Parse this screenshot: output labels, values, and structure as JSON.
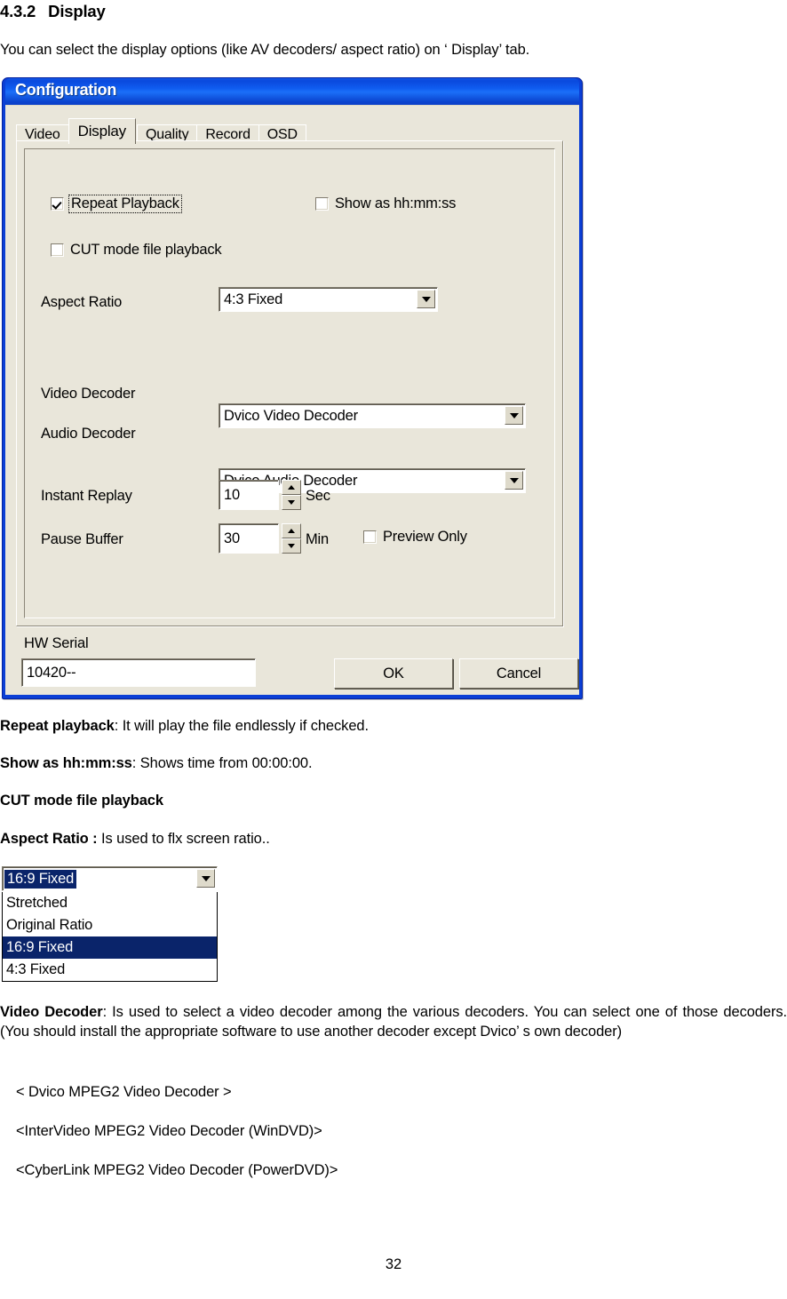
{
  "document": {
    "heading": {
      "number": "4.3.2",
      "title": "Display"
    },
    "intro": "You can select the display options (like AV decoders/ aspect ratio) on ‘ Display’  tab.",
    "notes": [
      {
        "term": "Repeat playback",
        "text": ": It will play the file endlessly if checked."
      },
      {
        "term": "Show as hh:mm:ss",
        "text": ": Shows time from 00:00:00."
      },
      {
        "term": "CUT mode file playback",
        "text": ""
      },
      {
        "term": "Aspect Ratio : ",
        "text": "Is used to flx screen ratio.."
      }
    ],
    "video_decoder_note": {
      "term": "Video Decoder",
      "text": ": Is used to select a video decoder among the various decoders. You can select one of those decoders. (You should install the appropriate software to use another decoder except Dvico’ s own decoder)"
    },
    "decoder_list": [
      "< Dvico MPEG2 Video Decoder >",
      "<InterVideo MPEG2 Video Decoder (WinDVD)>",
      "<CyberLink MPEG2 Video Decoder (PowerDVD)>"
    ],
    "page_number": "32"
  },
  "dialog": {
    "title": "Configuration",
    "tabs": [
      {
        "label": "Video",
        "active": false
      },
      {
        "label": "Display",
        "active": true
      },
      {
        "label": "Quality",
        "active": false
      },
      {
        "label": "Record",
        "active": false
      },
      {
        "label": "OSD",
        "active": false
      }
    ],
    "checkboxes": {
      "repeat_playback": {
        "label": "Repeat Playback",
        "checked": true,
        "focused": true
      },
      "show_as_hhmmss": {
        "label": "Show as hh:mm:ss",
        "checked": false
      },
      "cut_mode_file_playback": {
        "label": "CUT mode file playback",
        "checked": false
      },
      "preview_only": {
        "label": "Preview Only",
        "checked": false
      }
    },
    "fields": {
      "aspect_ratio": {
        "label": "Aspect Ratio",
        "value": "4:3 Fixed"
      },
      "video_decoder": {
        "label": "Video Decoder",
        "value": "Dvico Video Decoder"
      },
      "audio_decoder": {
        "label": "Audio Decoder",
        "value": "Dvico Audio Decoder"
      },
      "instant_replay": {
        "label": "Instant Replay",
        "value": "10",
        "unit": "Sec"
      },
      "pause_buffer": {
        "label": "Pause Buffer",
        "value": "30",
        "unit": "Min"
      },
      "hw_serial": {
        "label": "HW Serial",
        "value": "10420--"
      }
    },
    "buttons": {
      "ok": "OK",
      "cancel": "Cancel"
    },
    "colors": {
      "titlebar_blue": "#0f5cf0",
      "frame_blue": "#0b3fd6",
      "client_face": "#e9e6da",
      "highlight_navy": "#0a246a"
    }
  },
  "aspect_dropdown": {
    "selected": "16:9 Fixed",
    "options": [
      "Stretched",
      "Original Ratio",
      "16:9 Fixed",
      "4:3 Fixed"
    ]
  }
}
